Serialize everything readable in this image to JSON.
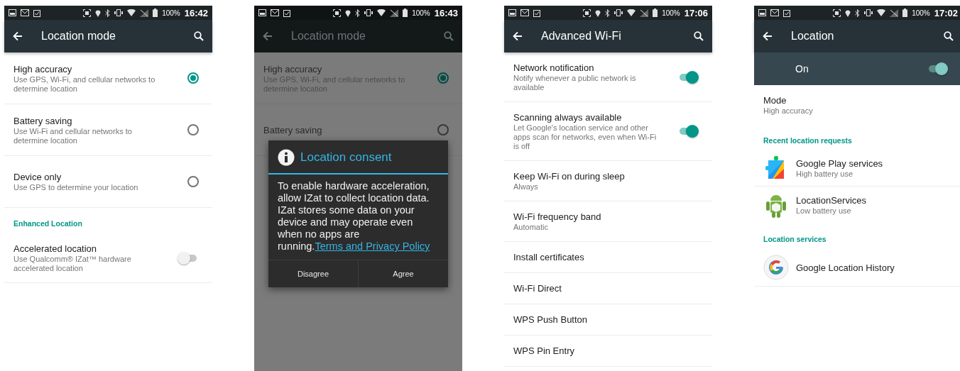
{
  "screens": [
    {
      "status_bar": {
        "battery": "100%",
        "time": "16:42"
      },
      "app_bar": {
        "title": "Location mode"
      },
      "dimmed": false,
      "items": [
        {
          "kind": "radio",
          "title": "High accuracy",
          "summary": "Use GPS, Wi-Fi, and cellular networks to determine location",
          "selected": true
        },
        {
          "kind": "radio",
          "title": "Battery saving",
          "summary": "Use Wi-Fi and cellular networks to determine location",
          "selected": false
        },
        {
          "kind": "radio",
          "title": "Device only",
          "summary": "Use GPS to determine your location",
          "selected": false
        },
        {
          "kind": "header",
          "title": "Enhanced Location"
        },
        {
          "kind": "switch",
          "title": "Accelerated location",
          "summary": "Use Qualcomm® IZat™ hardware accelerated location",
          "on": false
        }
      ]
    },
    {
      "status_bar": {
        "battery": "100%",
        "time": "16:43"
      },
      "app_bar": {
        "title": "Location mode"
      },
      "dimmed": true,
      "items": [
        {
          "kind": "radio",
          "title": "High accuracy",
          "summary": "Use GPS, Wi-Fi, and cellular networks to determine location",
          "selected": true
        },
        {
          "kind": "radio",
          "title": "Battery saving",
          "selected": false
        }
      ],
      "dialog": {
        "title": "Location consent",
        "body": "To enable hardware acceleration, allow IZat to collect location data. IZat stores some data on your device and may operate even when no apps are running.",
        "link": "Terms and Privacy Policy",
        "buttons": [
          "Disagree",
          "Agree"
        ]
      }
    },
    {
      "status_bar": {
        "battery": "100%",
        "time": "17:06"
      },
      "app_bar": {
        "title": "Advanced Wi-Fi"
      },
      "dimmed": false,
      "items": [
        {
          "kind": "switch",
          "title": "Network notification",
          "summary": "Notify whenever a public network is available",
          "on": true
        },
        {
          "kind": "switch",
          "title": "Scanning always available",
          "summary": "Let Google's location service and other apps scan for networks, even when Wi-Fi is off",
          "on": true
        },
        {
          "kind": "plain",
          "title": "Keep Wi-Fi on during sleep",
          "summary": "Always"
        },
        {
          "kind": "plain",
          "title": "Wi-Fi frequency band",
          "summary": "Automatic"
        },
        {
          "kind": "plain",
          "title": "Install certificates"
        },
        {
          "kind": "plain",
          "title": "Wi-Fi Direct"
        },
        {
          "kind": "plain",
          "title": "WPS Push Button"
        },
        {
          "kind": "plain",
          "title": "WPS Pin Entry"
        }
      ]
    },
    {
      "status_bar": {
        "battery": "100%",
        "time": "17:02"
      },
      "app_bar": {
        "title": "Location"
      },
      "dimmed": false,
      "master_switch": {
        "label": "On",
        "on": true
      },
      "items": [
        {
          "kind": "plain",
          "title": "Mode",
          "summary": "High accuracy",
          "divider": false
        },
        {
          "kind": "header",
          "title": "Recent location requests"
        },
        {
          "kind": "app",
          "title": "Google Play services",
          "summary": "High battery use"
        },
        {
          "kind": "app",
          "title": "LocationServices",
          "summary": "Low battery use",
          "divider": false
        },
        {
          "kind": "header",
          "title": "Location services"
        },
        {
          "kind": "app",
          "title": "Google Location History"
        }
      ]
    }
  ]
}
